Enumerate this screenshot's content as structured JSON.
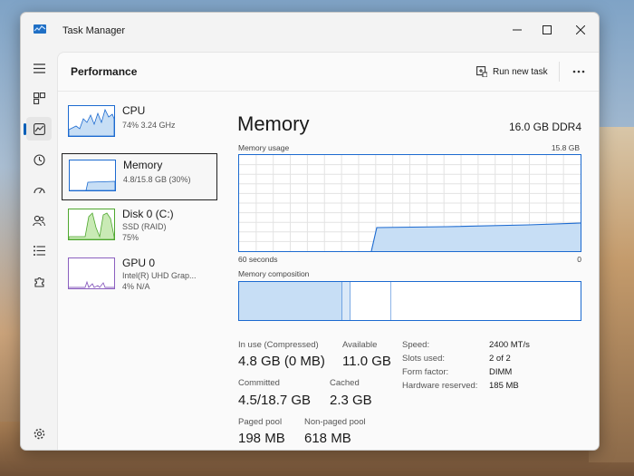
{
  "window": {
    "title": "Task Manager"
  },
  "colors": {
    "accent": "#005fb8",
    "memory": "#1c6ad0",
    "disk": "#4ea72e",
    "gpu": "#8b5fbf"
  },
  "header": {
    "title": "Performance",
    "run_new_task": "Run new task"
  },
  "devices": [
    {
      "name": "CPU",
      "sub1": "74% 3.24 GHz",
      "sub2": ""
    },
    {
      "name": "Memory",
      "sub1": "4.8/15.8 GB (30%)",
      "sub2": ""
    },
    {
      "name": "Disk 0 (C:)",
      "sub1": "SSD (RAID)",
      "sub2": "75%"
    },
    {
      "name": "GPU 0",
      "sub1": "Intel(R) UHD Grap...",
      "sub2": "4% N/A"
    }
  ],
  "memory": {
    "title": "Memory",
    "spec": "16.0 GB DDR4",
    "usage_label": "Memory usage",
    "max_label": "15.8 GB",
    "time_left": "60 seconds",
    "time_right": "0",
    "composition_label": "Memory composition"
  },
  "stats": {
    "in_use_label": "In use (Compressed)",
    "in_use_value": "4.8 GB (0 MB)",
    "available_label": "Available",
    "available_value": "11.0 GB",
    "committed_label": "Committed",
    "committed_value": "4.5/18.7 GB",
    "cached_label": "Cached",
    "cached_value": "2.3 GB",
    "paged_label": "Paged pool",
    "paged_value": "198 MB",
    "nonpaged_label": "Non-paged pool",
    "nonpaged_value": "618 MB"
  },
  "details": [
    {
      "label": "Speed:",
      "value": "2400 MT/s"
    },
    {
      "label": "Slots used:",
      "value": "2 of 2"
    },
    {
      "label": "Form factor:",
      "value": "DIMM"
    },
    {
      "label": "Hardware reserved:",
      "value": "185 MB"
    }
  ]
}
